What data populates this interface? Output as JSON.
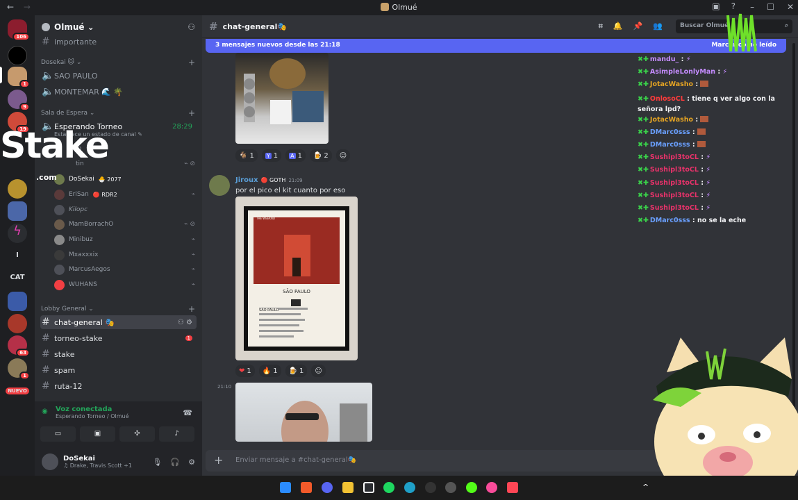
{
  "window": {
    "title": "Olmué",
    "back": "←",
    "forward": "→"
  },
  "servers": {
    "badge_top": "106",
    "badges": [
      "1",
      "9",
      "19",
      "1",
      "63",
      "1"
    ],
    "text_items": [
      "I",
      "CAT"
    ],
    "new_label": "NUEVO"
  },
  "guild": {
    "name": "Olmué ⌄"
  },
  "sidebar": {
    "important": "importante",
    "cat_dosekai": "Dosekai 🐱 ⌄",
    "sao_paulo": "SAO PAULO",
    "montemar": "MONTEMAR 🌊 🌴",
    "cat_sala": "Sala de Espera ⌄",
    "esperando": "Esperando Torneo",
    "esperando_time": "28:29",
    "esperando_status": "Establece un estado de canal ✎",
    "voice_users": [
      {
        "name": "lp",
        "tag": ""
      },
      {
        "name": "tin",
        "tag": ""
      },
      {
        "name": "DoSekai",
        "tag": "🐣 2077"
      },
      {
        "name": "EriSan",
        "tag": "🔴 RDR2"
      },
      {
        "name": "Kilopc",
        "tag": ""
      },
      {
        "name": "MamBorrachO",
        "tag": ""
      },
      {
        "name": "Minibuz",
        "tag": ""
      },
      {
        "name": "Mxaxxxix",
        "tag": ""
      },
      {
        "name": "MarcusAegos",
        "tag": ""
      },
      {
        "name": "WUHANS",
        "tag": ""
      }
    ],
    "cat_lobby": "Lobby General ⌄",
    "channels": [
      {
        "name": "chat-general 🎭",
        "active": true
      },
      {
        "name": "torneo-stake",
        "badge": "1"
      },
      {
        "name": "stake"
      },
      {
        "name": "spam"
      },
      {
        "name": "ruta-12"
      }
    ]
  },
  "voicebar": {
    "status": "Voz conectada",
    "sub": "Esperando Torneo / Olmué"
  },
  "user": {
    "name": "DoSekai",
    "status": "♫ Drake, Travis Scott +1"
  },
  "chat": {
    "channel": "chat-general🎭",
    "search_placeholder": "Buscar Olmué",
    "new_messages": "3 mensajes nuevos desde las 21:18",
    "mark_read": "Marcar como leído",
    "reactions_1": [
      {
        "e": "🐐",
        "n": "1"
      },
      {
        "e": "Y",
        "n": "1"
      },
      {
        "e": "A",
        "n": "1"
      },
      {
        "e": "🍺",
        "n": "2"
      }
    ],
    "author": "Jiroux",
    "role": "🔴 GOTH",
    "time": "21:09",
    "message": "por el pico el kit cuanto por eso",
    "reactions_2": [
      {
        "e": "❤",
        "n": "1"
      },
      {
        "e": "🔥",
        "n": "1"
      },
      {
        "e": "🍺",
        "n": "1"
      }
    ],
    "time2": "21:10",
    "composer_placeholder": "Enviar mensaje a #chat-general🎭",
    "album": {
      "top": "THE WEEKND",
      "city": "SÃO PAULO",
      "heading": "SÃO PAULO"
    }
  },
  "overlay_chat": [
    {
      "user": "mandu_",
      "color": "#c58cff",
      "msg": "",
      "emote": "pepe"
    },
    {
      "user": "AsimpleLonlyMan",
      "color": "#c58cff",
      "msg": "",
      "emote": "pepe"
    },
    {
      "user": "JotacWasho",
      "color": "#e5a423",
      "msg": "",
      "emote": "box"
    },
    {
      "user": "OnlosoCL",
      "color": "#ff3b3b",
      "msg": "tiene q ver algo con la señora lpd?",
      "emote": ""
    },
    {
      "user": "JotacWasho",
      "color": "#e5a423",
      "msg": "",
      "emote": "box"
    },
    {
      "user": "DMarc0sss",
      "color": "#6aa0ff",
      "msg": "",
      "emote": "box"
    },
    {
      "user": "DMarc0sss",
      "color": "#6aa0ff",
      "msg": "",
      "emote": "box"
    },
    {
      "user": "Sushipl3toCL",
      "color": "#e8326a",
      "msg": "",
      "emote": "pepe"
    },
    {
      "user": "Sushipl3toCL",
      "color": "#e8326a",
      "msg": "",
      "emote": "pepe"
    },
    {
      "user": "Sushipl3toCL",
      "color": "#e8326a",
      "msg": "",
      "emote": "pepe"
    },
    {
      "user": "Sushipl3toCL",
      "color": "#e8326a",
      "msg": "",
      "emote": "pepe"
    },
    {
      "user": "Sushipl3toCL",
      "color": "#e8326a",
      "msg": "",
      "emote": "pepe"
    },
    {
      "user": "DMarc0sss",
      "color": "#6aa0ff",
      "msg": "no se la eche",
      "emote": ""
    }
  ],
  "stake": {
    "logo": "Stake",
    "com": ".com"
  }
}
